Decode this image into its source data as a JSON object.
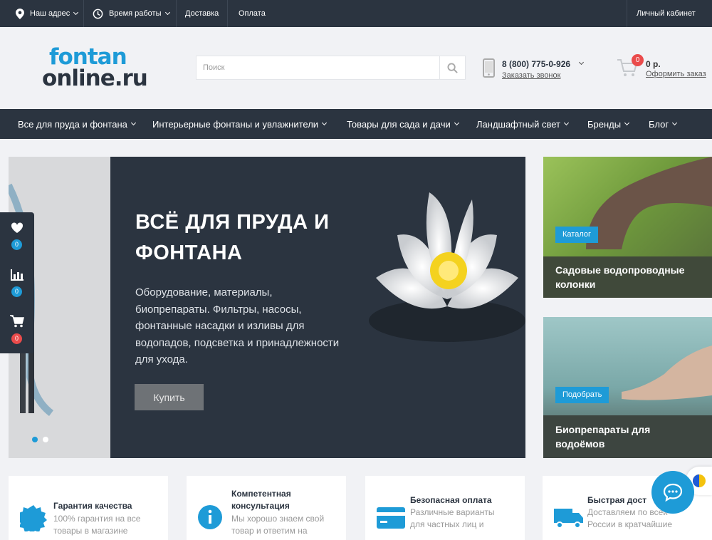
{
  "topbar": {
    "address": "Наш адрес",
    "hours": "Время работы",
    "delivery": "Доставка",
    "payment": "Оплата",
    "account": "Личный кабинет"
  },
  "logo": {
    "line1": "fontan",
    "line2": "nline.ru",
    "line2_prefix": "o"
  },
  "search": {
    "placeholder": "Поиск"
  },
  "contact": {
    "phone": "8 (800) 775-0-926",
    "callback": "Заказать звонок"
  },
  "cart": {
    "count": "0",
    "sum": "0 р.",
    "checkout": "Оформить заказ"
  },
  "nav": {
    "items": [
      {
        "label": "Все для пруда и фонтана"
      },
      {
        "label": "Интерьерные фонтаны и увлажнители"
      },
      {
        "label": "Товары для сада и дачи"
      },
      {
        "label": "Ландшафтный свет"
      },
      {
        "label": "Бренды"
      },
      {
        "label": "Блог"
      }
    ]
  },
  "hero": {
    "title": "ВСЁ ДЛЯ ПРУДА И ФОНТАНА",
    "text": "Оборудование, материалы, биопрепараты. Фильтры, насосы, фонтанные насадки и изливы для водопадов, подсветка и принадлежности для ухода.",
    "button": "Купить"
  },
  "side_panel": {
    "favorites": "0",
    "compare": "0",
    "cart": "0"
  },
  "promos": [
    {
      "tag": "Каталог",
      "caption": "Садовые водопроводные колонки"
    },
    {
      "tag": "Подобрать",
      "caption": "Биопрепараты для водоёмов"
    }
  ],
  "features": [
    {
      "title": "Гарантия качества",
      "text": "100% гарантия на все товары в магазине"
    },
    {
      "title": "Компетентная консультация",
      "text": "Мы хорошо знаем свой товар и ответим на"
    },
    {
      "title": "Безопасная оплата",
      "text": "Различные варианты для частных лиц и"
    },
    {
      "title": "Быстрая дост",
      "text": "Доставляем по всей России в кратчайшие"
    }
  ],
  "colors": {
    "dark": "#2b3440",
    "accent": "#1e9bd7",
    "badge": "#ea4b4b"
  }
}
